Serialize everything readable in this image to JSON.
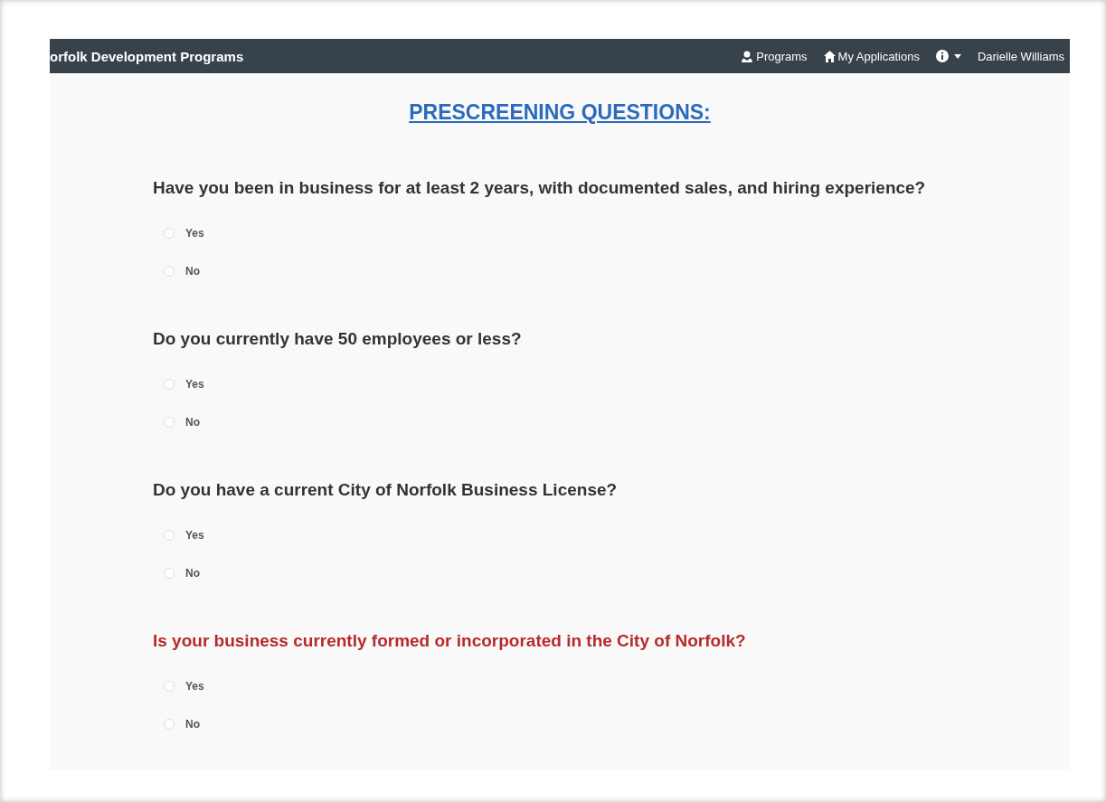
{
  "navbar": {
    "brand": "orfolk Development Programs",
    "links": [
      {
        "label": "Programs",
        "kind": "programs"
      },
      {
        "label": "My Applications",
        "kind": "applications"
      }
    ],
    "info_menu": {
      "expanded": false
    },
    "user": "Darielle Williams"
  },
  "heading": "PRESCREENING QUESTIONS:",
  "questions": [
    {
      "text": "Have you been in business for at least 2 years, with documented sales, and hiring experience?",
      "invalid": false,
      "options": [
        {
          "label": "Yes",
          "selected": false
        },
        {
          "label": "No",
          "selected": false
        }
      ]
    },
    {
      "text": "Do you currently have 50 employees or less?",
      "invalid": false,
      "options": [
        {
          "label": "Yes",
          "selected": false
        },
        {
          "label": "No",
          "selected": false
        }
      ]
    },
    {
      "text": "Do you have a current City of Norfolk Business License?",
      "invalid": false,
      "options": [
        {
          "label": "Yes",
          "selected": false
        },
        {
          "label": "No",
          "selected": false
        }
      ]
    },
    {
      "text": "Is your business currently formed or incorporated in the City of Norfolk?",
      "invalid": true,
      "options": [
        {
          "label": "Yes",
          "selected": false
        },
        {
          "label": "No",
          "selected": false
        }
      ]
    }
  ]
}
